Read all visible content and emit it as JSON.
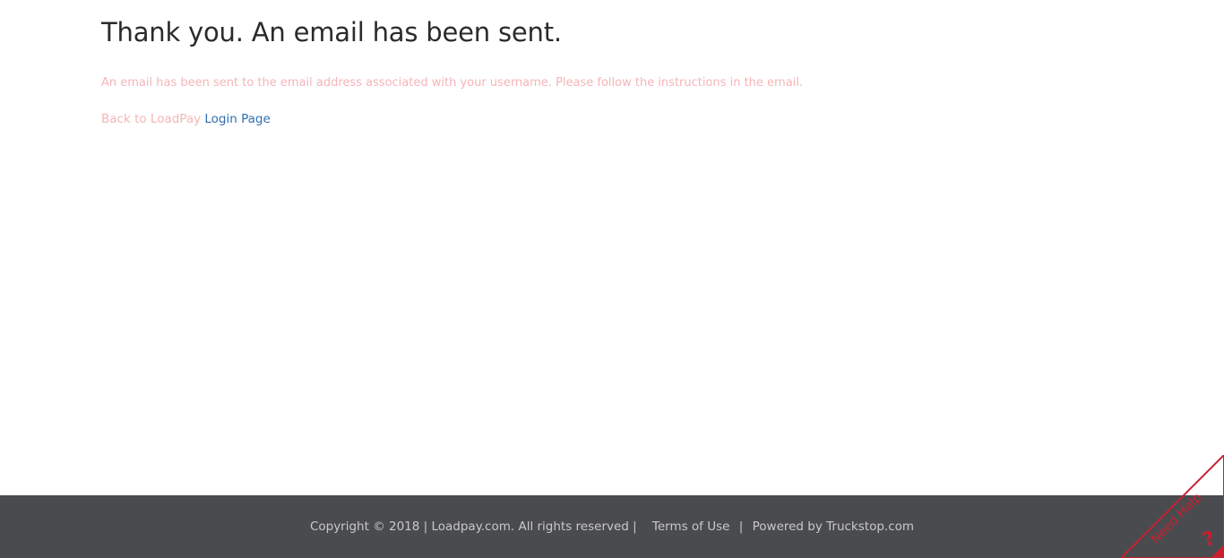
{
  "main": {
    "title": "Thank you. An email has been sent.",
    "message": "An email has been sent to the email address associated with your username. Please follow the instructions in the email.",
    "back_prefix": "Back to LoadPay",
    "login_link": "Login Page"
  },
  "footer": {
    "copyright": "Copyright © 2018 | Loadpay.com. All rights reserved |",
    "terms_link": "Terms of Use",
    "separator": "|",
    "powered_by": "Powered by Truckstop.com"
  },
  "help_widget": {
    "label": "Need Help",
    "icon": "question-mark-icon",
    "glyph": "?",
    "accent_color": "#c8202f"
  },
  "colors": {
    "message_text": "#f5b5b8",
    "link": "#2f6fb0",
    "footer_bg": "#4a4b4f"
  }
}
